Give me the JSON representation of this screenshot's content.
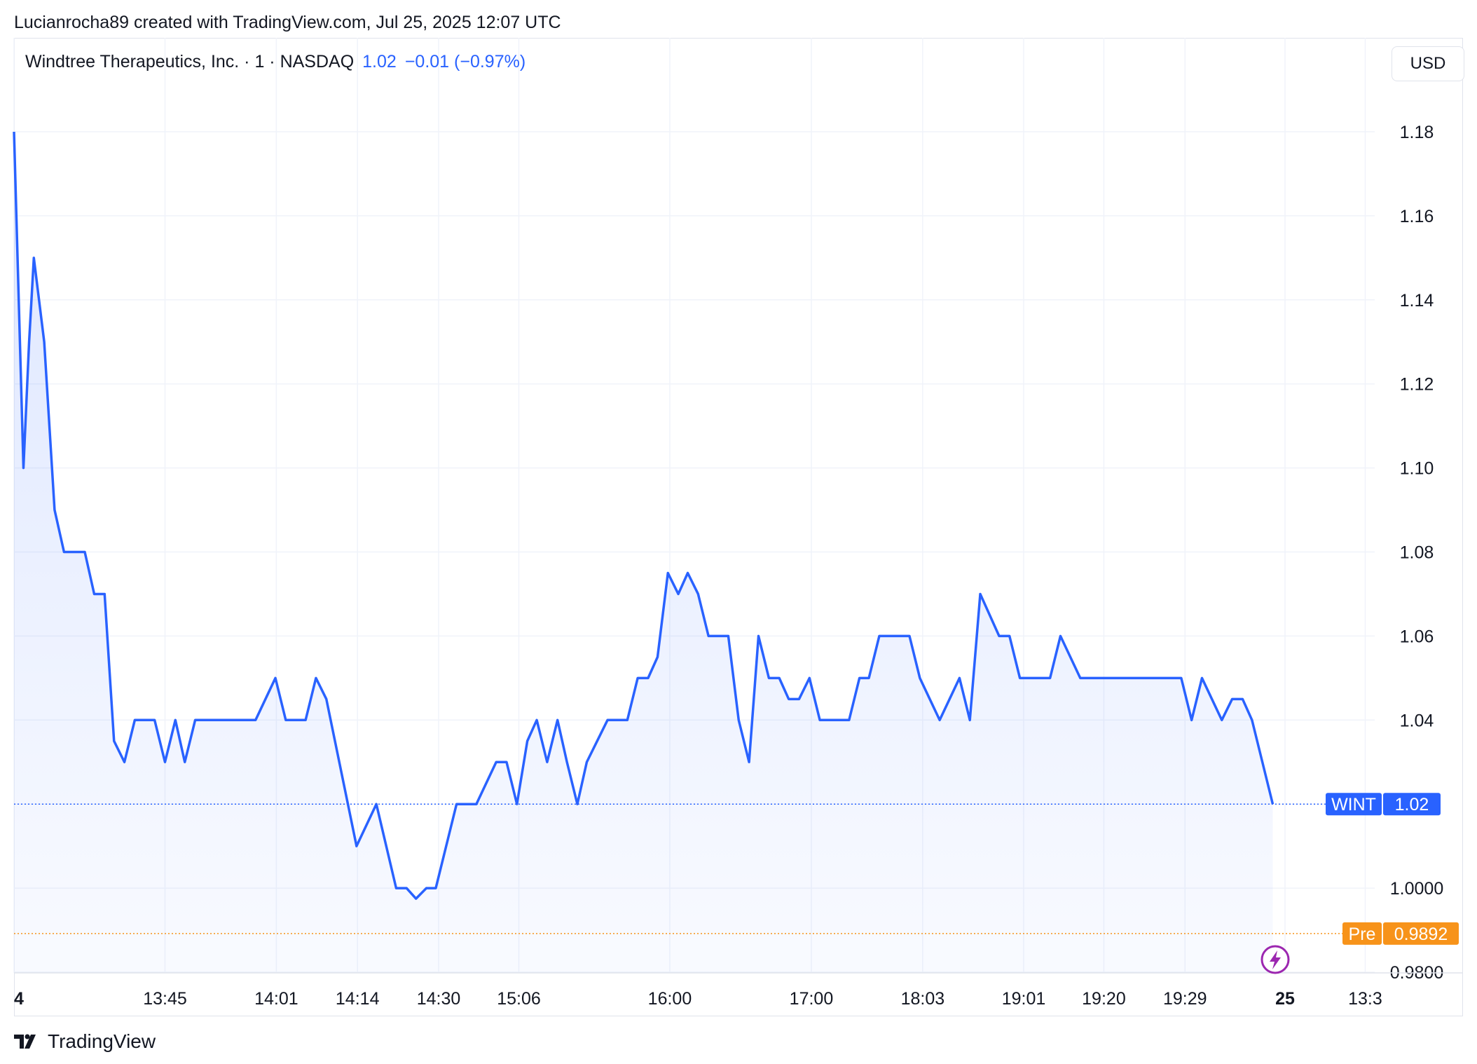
{
  "header": {
    "credit": "Lucianrocha89 created with TradingView.com, Jul 25, 2025 12:07 UTC"
  },
  "legend": {
    "symbol_line": "Windtree Therapeutics, Inc. · 1 · NASDAQ",
    "price": "1.02",
    "change": "−0.01 (−0.97%)"
  },
  "currency": "USD",
  "footer": {
    "brand": "TradingView",
    "logo_icon": "tradingview-logo-icon"
  },
  "colors": {
    "line": "#2962ff",
    "pre": "#f7931a",
    "grid": "#f0f3fa",
    "text": "#131722",
    "lightning": "#9c27b0"
  },
  "chart_data": {
    "type": "area",
    "title": "",
    "y_axis": {
      "ylim": [
        0.98,
        1.18
      ],
      "ticks": [
        1.18,
        1.16,
        1.14,
        1.12,
        1.1,
        1.08,
        1.06,
        1.04,
        1.02,
        1.0,
        0.98
      ],
      "tick_labels": [
        "1.18",
        "1.16",
        "1.14",
        "1.12",
        "1.10",
        "1.08",
        "1.06",
        "1.04",
        "",
        "1.0000",
        "0.9800"
      ],
      "position": "right"
    },
    "x_axis": {
      "xlim": [
        0,
        1340
      ],
      "ticks": [
        {
          "x": 0,
          "label": "4",
          "bold": true
        },
        {
          "x": 160,
          "label": "13:45"
        },
        {
          "x": 278,
          "label": "14:01"
        },
        {
          "x": 364,
          "label": "14:14"
        },
        {
          "x": 450,
          "label": "14:30"
        },
        {
          "x": 535,
          "label": "15:06"
        },
        {
          "x": 695,
          "label": "16:00"
        },
        {
          "x": 845,
          "label": "17:00"
        },
        {
          "x": 963,
          "label": "18:03"
        },
        {
          "x": 1070,
          "label": "19:01"
        },
        {
          "x": 1155,
          "label": "19:20"
        },
        {
          "x": 1241,
          "label": "19:29"
        },
        {
          "x": 1347,
          "label": "25",
          "bold": true
        },
        {
          "x": 1432,
          "label": "13:3"
        }
      ]
    },
    "grid": true,
    "series": [
      {
        "ticker": "WINT",
        "x": [
          0,
          10,
          16,
          21,
          32,
          43,
          53,
          75,
          85,
          96,
          106,
          117,
          128,
          149,
          160,
          171,
          181,
          192,
          256,
          277,
          288,
          309,
          320,
          331,
          363,
          384,
          405,
          416,
          426,
          437,
          447,
          469,
          490,
          511,
          522,
          533,
          544,
          554,
          565,
          576,
          586,
          597,
          607,
          629,
          650,
          661,
          672,
          682,
          693,
          704,
          714,
          725,
          736,
          757,
          768,
          779,
          789,
          800,
          811,
          821,
          832,
          843,
          854,
          885,
          896,
          906,
          917,
          949,
          960,
          981,
          1002,
          1013,
          1024,
          1044,
          1055,
          1066,
          1098,
          1109,
          1130,
          1237,
          1248,
          1259,
          1280,
          1291,
          1302,
          1312,
          1323,
          1334
        ],
        "values": [
          1.18,
          1.1,
          1.13,
          1.15,
          1.13,
          1.09,
          1.08,
          1.08,
          1.07,
          1.07,
          1.035,
          1.03,
          1.04,
          1.04,
          1.03,
          1.04,
          1.03,
          1.04,
          1.04,
          1.05,
          1.04,
          1.04,
          1.05,
          1.045,
          1.01,
          1.02,
          1.0,
          1.0,
          0.9975,
          1.0,
          1.0,
          1.02,
          1.02,
          1.03,
          1.03,
          1.02,
          1.035,
          1.04,
          1.03,
          1.04,
          1.03,
          1.02,
          1.03,
          1.04,
          1.04,
          1.05,
          1.05,
          1.055,
          1.075,
          1.07,
          1.075,
          1.07,
          1.06,
          1.06,
          1.04,
          1.03,
          1.06,
          1.05,
          1.05,
          1.045,
          1.045,
          1.05,
          1.04,
          1.04,
          1.05,
          1.05,
          1.06,
          1.06,
          1.05,
          1.04,
          1.05,
          1.04,
          1.07,
          1.06,
          1.06,
          1.05,
          1.05,
          1.06,
          1.05,
          1.05,
          1.04,
          1.05,
          1.04,
          1.045,
          1.045,
          1.04,
          1.03,
          1.02
        ]
      }
    ],
    "last_price_marker": {
      "label": "WINT",
      "value": 1.02,
      "text": "1.02"
    },
    "premarket_marker": {
      "label": "Pre",
      "value": 0.9892,
      "text": "0.9892"
    },
    "lightning_icon": "lightning-bolt-icon"
  }
}
